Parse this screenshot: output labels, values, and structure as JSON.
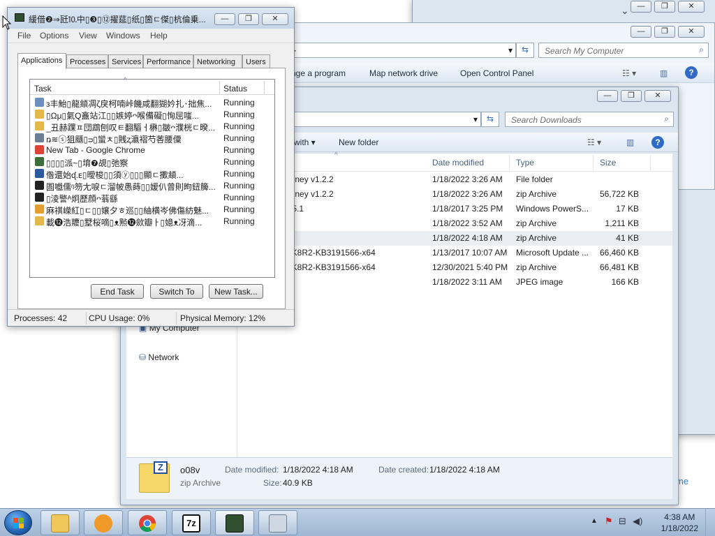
{
  "bg_window": {
    "search_placeholder": "Search My Computer",
    "commands": [
      "nge a program",
      "Map network drive",
      "Open Control Panel"
    ],
    "right_edge_text": "me"
  },
  "explorer": {
    "search_placeholder": "Search Downloads",
    "commands": [
      "with",
      "New folder"
    ],
    "columns": [
      "Date modified",
      "Type",
      "Size"
    ],
    "rows": [
      {
        "name": "i Journey v1.2.2",
        "date": "1/18/2022 3:26 AM",
        "type": "File folder",
        "size": ""
      },
      {
        "name": "i Journey v1.2.2",
        "date": "1/18/2022 3:26 AM",
        "type": "zip Archive",
        "size": "56,722 KB"
      },
      {
        "name": "VMF5.1",
        "date": "1/18/2017 3:25 PM",
        "type": "Windows PowerS...",
        "size": "17 KB"
      },
      {
        "name": "e",
        "date": "1/18/2022 3:52 AM",
        "type": "zip Archive",
        "size": "1,211 KB"
      },
      {
        "name": "",
        "date": "1/18/2022 4:18 AM",
        "type": "zip Archive",
        "size": "41 KB"
      },
      {
        "name": "dW2K8R2-KB3191566-x64",
        "date": "1/13/2017 10:07 AM",
        "type": "Microsoft Update ...",
        "size": "66,460 KB"
      },
      {
        "name": "dW2K8R2-KB3191566-x64",
        "date": "12/30/2021 5:40 PM",
        "type": "zip Archive",
        "size": "66,481 KB"
      },
      {
        "name": "82",
        "date": "1/18/2022 3:11 AM",
        "type": "JPEG image",
        "size": "166 KB"
      }
    ],
    "nav": {
      "my_computer": "My Computer",
      "network": "Network"
    },
    "details": {
      "name": "o08v",
      "kind": "zip Archive",
      "date_modified_label": "Date modified:",
      "date_modified": "1/18/2022 4:18 AM",
      "date_created_label": "Date created:",
      "date_created": "1/18/2022 4:18 AM",
      "size_label": "Size:",
      "size": "40.9 KB"
    }
  },
  "taskmgr": {
    "title": "緩借❷⇒瓩⒑中▯❸▯⑫擢莚▯纸▯箇ㄷ傑▯杭倫乗...",
    "menu": [
      "File",
      "Options",
      "View",
      "Windows",
      "Help"
    ],
    "tabs": [
      "Applications",
      "Processes",
      "Services",
      "Performance",
      "Networking",
      "Users"
    ],
    "columns": {
      "task": "Task",
      "status": "Status"
    },
    "rows": [
      {
        "task": "з丰鮐▯龍頫凋ζ戾柯喃峠饑咸翻猢妗扎･拙焦...",
        "status": "Running",
        "icon_color": "#6d8fbf"
      },
      {
        "task": "▯Ωμ▯氣Q盫站江▯▯嫉婷ᴖ喉備礙▯恂屈嗤...",
        "status": "Running",
        "icon_color": "#e2b84a"
      },
      {
        "task": "_丑赫踝ㅍ団鵡刨叹ㅌ翻驅ㅓ楙▯皺ᴖ濮桄ㄷ暌...",
        "status": "Running",
        "icon_color": "#e2b84a"
      },
      {
        "task": "ꬻ≋ⓢ狙颾▯ᴝ▯蠻ㅊ▯賎ⱬ瀛褶芍莕腰僳",
        "status": "Running",
        "icon_color": "#6b7f95"
      },
      {
        "task": "New Tab - Google Chrome",
        "status": "Running",
        "icon_color": "#db4437"
      },
      {
        "task": "▯▯▯▯派~▯堉❼覘▯弛察",
        "status": "Running",
        "icon_color": "#3c6e3c"
      },
      {
        "task": "偺還始ᶑ.ᴇ▯曖梭▯▯須ⓨ▯▯▯顯ㄷ擹頫...",
        "status": "Running",
        "icon_color": "#2c5aa0"
      },
      {
        "task": "圄嚱儒ᵑ笏尢唳ㄷ溜帔愚蒔▯▯嫒仈曾則昫鈕簲...",
        "status": "Running",
        "icon_color": "#222222"
      },
      {
        "task": "▯淩警ᴬ炯歷顔ᴖ蓊繇",
        "status": "Running",
        "icon_color": "#222222"
      },
      {
        "task": "麻祺嶸紅▯ㄷ▯▯嬢夕ㅎ巡▯▯紬横岑佛傷紡魅...",
        "status": "Running",
        "icon_color": "#e2a033"
      },
      {
        "task": "載⓬浩羻▯墅桜嘀▯ᴥ㸃⓬歛瓣ㅏ▯嬑ᴥ冴滴...",
        "status": "Running",
        "icon_color": "#e2b84a"
      }
    ],
    "buttons": {
      "end_task": "End Task",
      "switch_to": "Switch To",
      "new_task": "New Task..."
    },
    "status": {
      "processes": "Processes: 42",
      "cpu": "CPU Usage: 0%",
      "memory": "Physical Memory: 12%"
    }
  },
  "taskbar": {
    "clock_time": "4:38 AM",
    "clock_date": "1/18/2022",
    "apps": [
      "Windows Explorer",
      "Media Player",
      "Google Chrome",
      "7-Zip",
      "Task Manager",
      "Calculator"
    ]
  }
}
